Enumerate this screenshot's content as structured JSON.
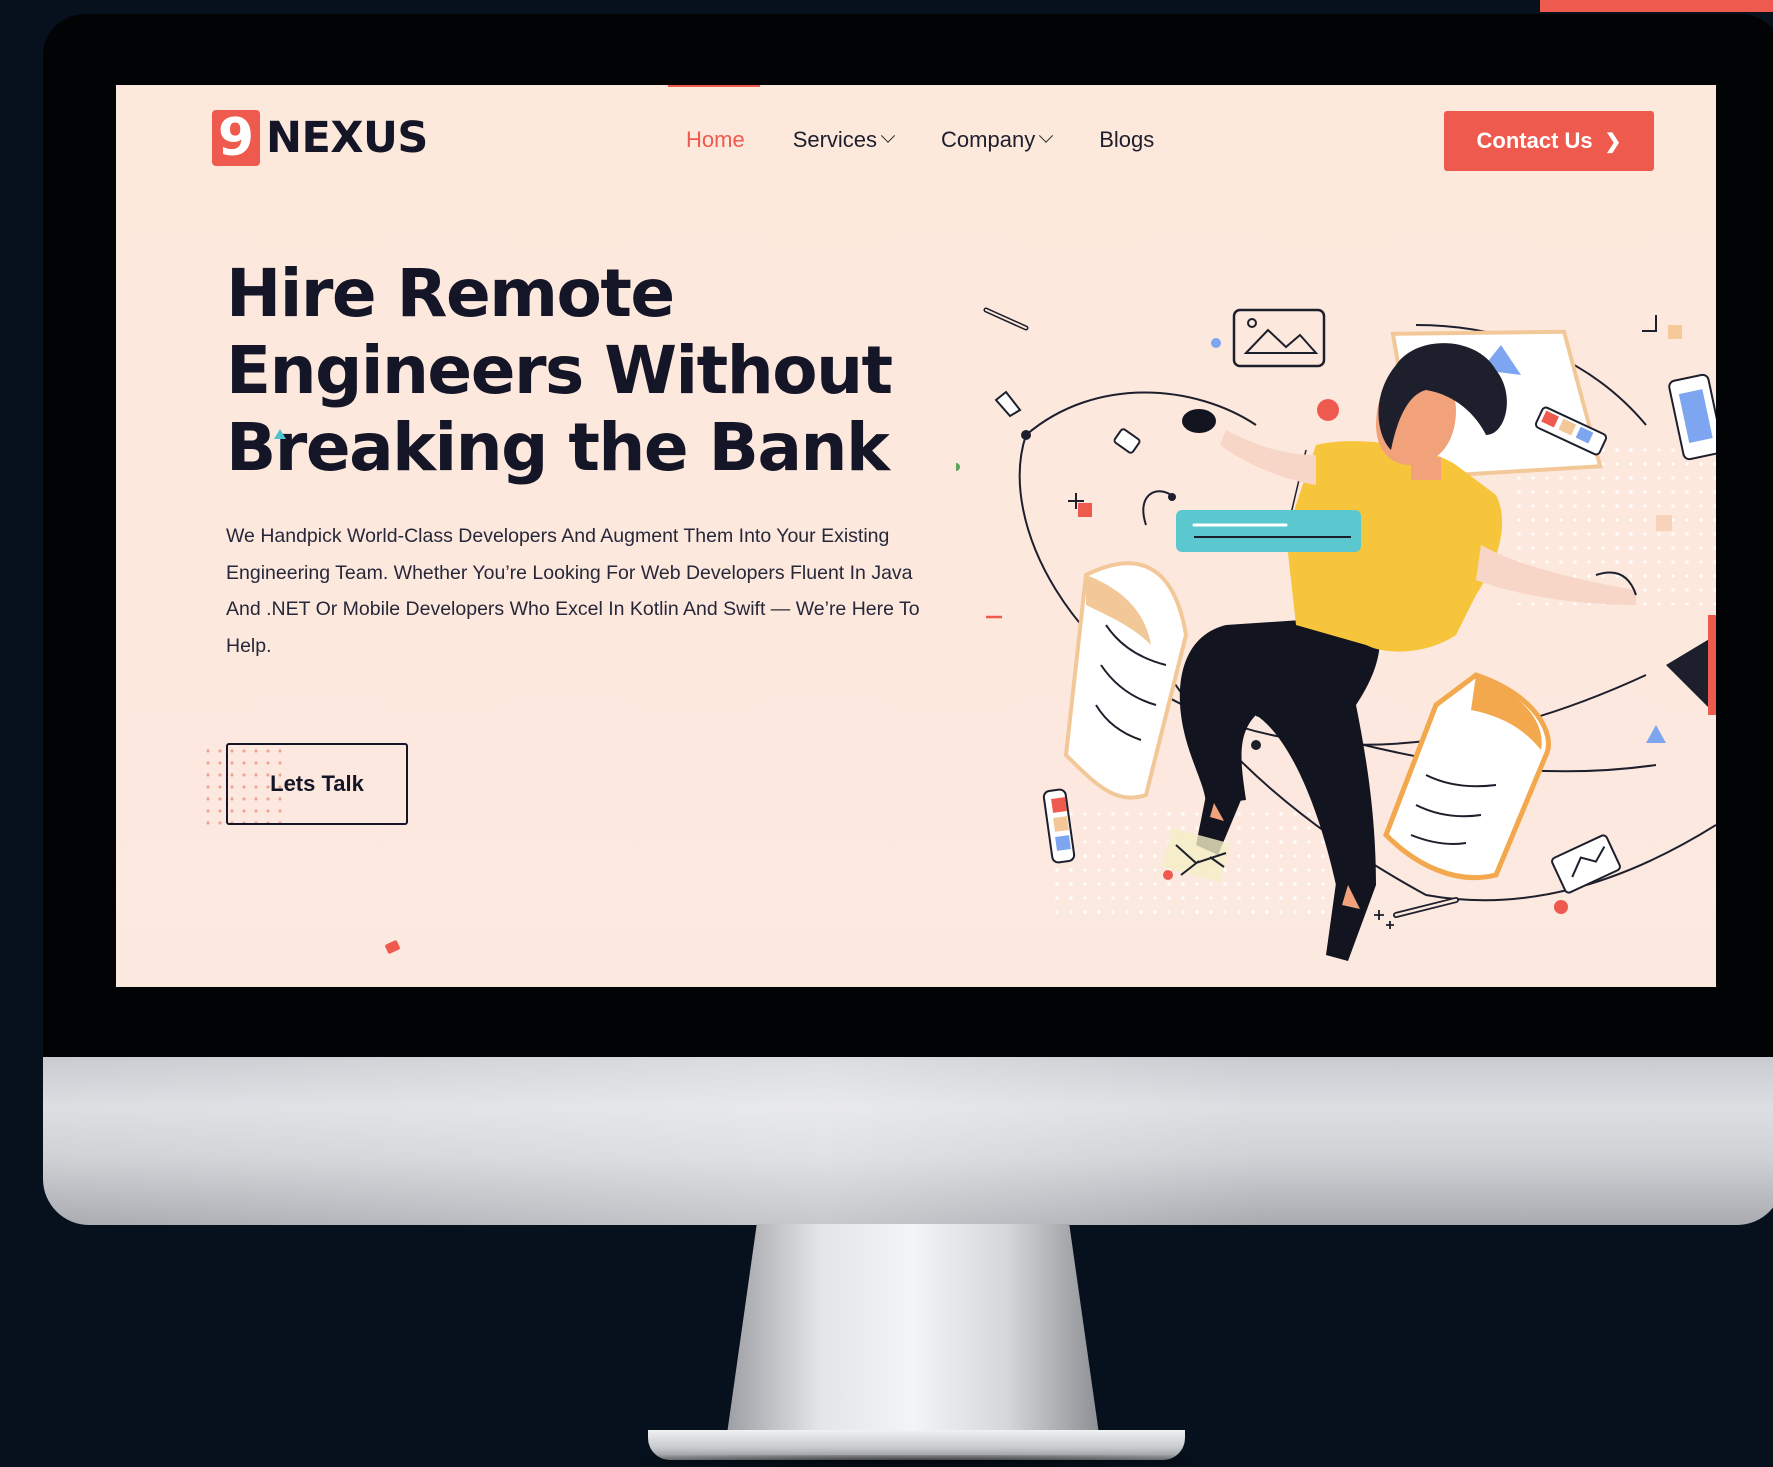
{
  "brand": {
    "logo_mark": "9",
    "logo_text": "NEXUS",
    "accent_color": "#ef5a4e",
    "background_color": "#fde8dc",
    "text_color": "#141526"
  },
  "nav": {
    "items": [
      {
        "label": "Home",
        "active": true,
        "dropdown": false
      },
      {
        "label": "Services",
        "active": false,
        "dropdown": true
      },
      {
        "label": "Company",
        "active": false,
        "dropdown": true
      },
      {
        "label": "Blogs",
        "active": false,
        "dropdown": false
      }
    ],
    "contact_label": "Contact Us",
    "contact_icon": "chevron-right-icon"
  },
  "hero": {
    "title_lines": [
      "Hire Remote",
      "Engineers Without",
      "Breaking the Bank"
    ],
    "description": "We Handpick World-Class Developers And Augment Them Into Your Existing Engineering Team. Whether You’re Looking For Web Developers Fluent In Java And .NET Or Mobile Developers Who Excel In Kotlin And Swift — We’re Here To Help.",
    "cta_label": "Lets Talk"
  },
  "illustration": {
    "icon": "developer-illustration-icon",
    "colors": {
      "shirt": "#f6c53c",
      "pants": "#121420",
      "skin": "#f2a27a",
      "bar": "#5bc8d0",
      "paper_accent": "#f3a84e"
    }
  }
}
